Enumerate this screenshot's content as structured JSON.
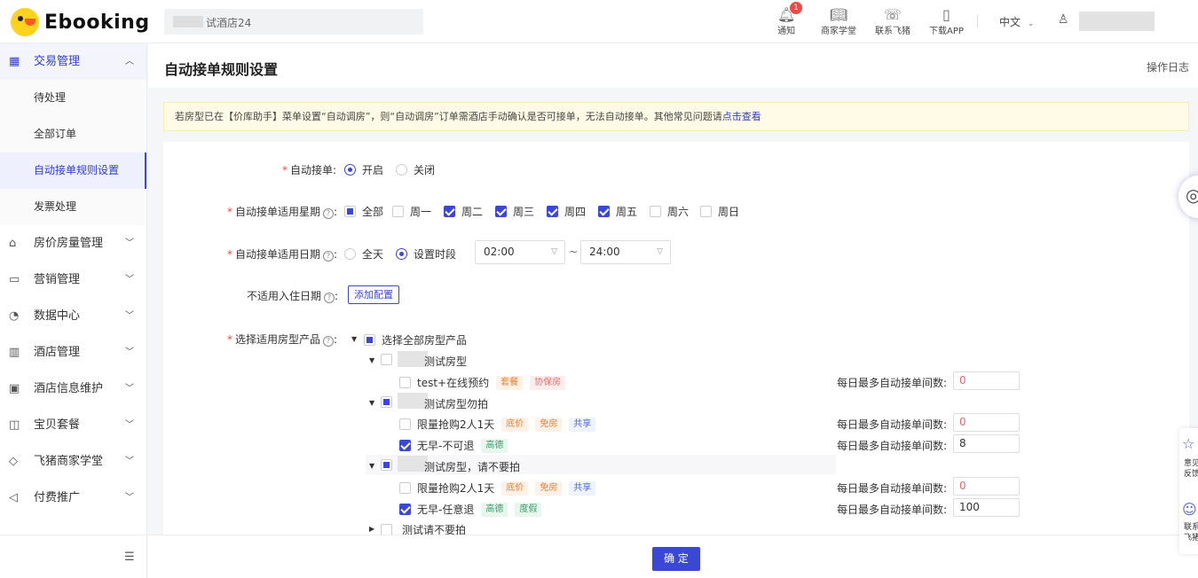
{
  "header": {
    "logo_text": "Ebooking",
    "hotel_name": "试酒店24",
    "icons": [
      {
        "name": "notification",
        "label": "通知",
        "badge": "1"
      },
      {
        "name": "merchant-school",
        "label": "商家学堂"
      },
      {
        "name": "contact",
        "label": "联系飞猪"
      },
      {
        "name": "download",
        "label": "下载APP"
      }
    ],
    "language": "中文"
  },
  "sidebar": {
    "open_group": {
      "label": "交易管理",
      "items": [
        "待处理",
        "全部订单",
        "自动接单规则设置",
        "发票处理"
      ],
      "active": "自动接单规则设置"
    },
    "groups": [
      "房价房量管理",
      "营销管理",
      "数据中心",
      "酒店管理",
      "酒店信息维护",
      "宝贝套餐",
      "飞猪商家学堂",
      "付费推广"
    ]
  },
  "page": {
    "title": "自动接单规则设置",
    "operation_log": "操作日志",
    "notice_text": "若房型已在【价库助手】菜单设置“自动调房”，则“自动调房”订单需酒店手动确认是否可接单，无法自动接单。其他常见问题请",
    "notice_link": "点击查看"
  },
  "form": {
    "auto_accept": {
      "label": "自动接单",
      "options": [
        "开启",
        "关闭"
      ],
      "selected": "开启"
    },
    "weekdays": {
      "label": "自动接单适用星期",
      "all_label": "全部",
      "days": [
        {
          "label": "周一",
          "checked": false
        },
        {
          "label": "周二",
          "checked": true
        },
        {
          "label": "周三",
          "checked": true
        },
        {
          "label": "周四",
          "checked": true
        },
        {
          "label": "周五",
          "checked": true
        },
        {
          "label": "周六",
          "checked": false
        },
        {
          "label": "周日",
          "checked": false
        }
      ]
    },
    "date_range": {
      "label": "自动接单适用日期",
      "options": [
        "全天",
        "设置时段"
      ],
      "selected": "设置时段",
      "start": "02:00",
      "end": "24:00",
      "separator": "~"
    },
    "excluded_dates": {
      "label": "不适用入住日期",
      "button": "添加配置"
    },
    "room_products": {
      "label": "选择适用房型产品",
      "all_label": "选择全部房型产品",
      "daily_label": "每日最多自动接单间数:",
      "rooms": [
        {
          "name": "测试房型",
          "products": [
            {
              "name": "test+在线预约",
              "checked": false,
              "tags": [
                "套餐",
                "协保房"
              ],
              "value": "0"
            }
          ]
        },
        {
          "name": "测试房型勿拍",
          "products": [
            {
              "name": "限量抢购2人1天",
              "checked": false,
              "tags": [
                "底价",
                "免房",
                "共享"
              ],
              "value": "0"
            },
            {
              "name": "无早-不可退",
              "checked": true,
              "tags": [
                "高德"
              ],
              "value": "8"
            }
          ]
        },
        {
          "name": "测试房型，请不要拍",
          "products": [
            {
              "name": "限量抢购2人1天",
              "checked": false,
              "tags": [
                "底价",
                "免房",
                "共享"
              ],
              "value": "0"
            },
            {
              "name": "无早-任意退",
              "checked": true,
              "tags": [
                "高德",
                "度假"
              ],
              "value": "100"
            }
          ]
        },
        {
          "name": "测试请不要拍",
          "products": []
        }
      ]
    }
  },
  "footer": {
    "confirm": "确 定"
  },
  "float": {
    "feedback": "意见反馈",
    "contact": "联系飞猪"
  },
  "colors": {
    "primary": "#3b47d6",
    "required": "#f04844",
    "notice_bg": "#fffbe6"
  }
}
